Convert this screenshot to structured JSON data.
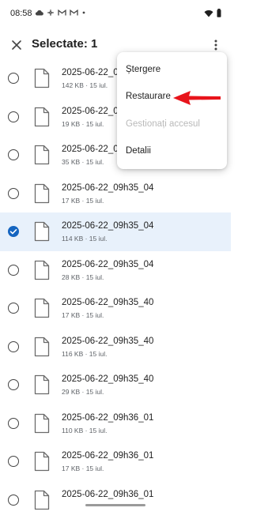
{
  "status_bar": {
    "time": "08:58",
    "left_icons": [
      "cloud-icon",
      "fan-icon",
      "gmail-icon",
      "gmail-icon",
      "dot-icon"
    ],
    "right_icons": [
      "wifi-icon",
      "battery-icon"
    ]
  },
  "header": {
    "title": "Selectate: 1",
    "close_icon": "close-icon",
    "more_icon": "more-vertical-icon"
  },
  "files": [
    {
      "name": "2025-06-22_0",
      "meta": "142 KB · 15 iul.",
      "selected": false
    },
    {
      "name": "2025-06-22_0",
      "meta": "19 KB · 15 iul.",
      "selected": false
    },
    {
      "name": "2025-06-22_0",
      "meta": "35 KB · 15 iul.",
      "selected": false
    },
    {
      "name": "2025-06-22_09h35_04",
      "meta": "17 KB · 15 iul.",
      "selected": false
    },
    {
      "name": "2025-06-22_09h35_04",
      "meta": "114 KB · 15 iul.",
      "selected": true
    },
    {
      "name": "2025-06-22_09h35_04",
      "meta": "28 KB · 15 iul.",
      "selected": false
    },
    {
      "name": "2025-06-22_09h35_40",
      "meta": "17 KB · 15 iul.",
      "selected": false
    },
    {
      "name": "2025-06-22_09h35_40",
      "meta": "116 KB · 15 iul.",
      "selected": false
    },
    {
      "name": "2025-06-22_09h35_40",
      "meta": "29 KB · 15 iul.",
      "selected": false
    },
    {
      "name": "2025-06-22_09h36_01",
      "meta": "110 KB · 15 iul.",
      "selected": false
    },
    {
      "name": "2025-06-22_09h36_01",
      "meta": "17 KB · 15 iul.",
      "selected": false
    },
    {
      "name": "2025-06-22_09h36_01",
      "meta": "",
      "selected": false
    }
  ],
  "menu": {
    "items": [
      {
        "label": "Ștergere",
        "enabled": true
      },
      {
        "label": "Restaurare",
        "enabled": true
      },
      {
        "label": "Gestionați accesul",
        "enabled": false
      },
      {
        "label": "Detalii",
        "enabled": true
      }
    ]
  },
  "annotation": {
    "arrow_color": "#e8141b"
  },
  "colors": {
    "accent": "#1565c0",
    "selected_row": "#e8f1fb"
  }
}
